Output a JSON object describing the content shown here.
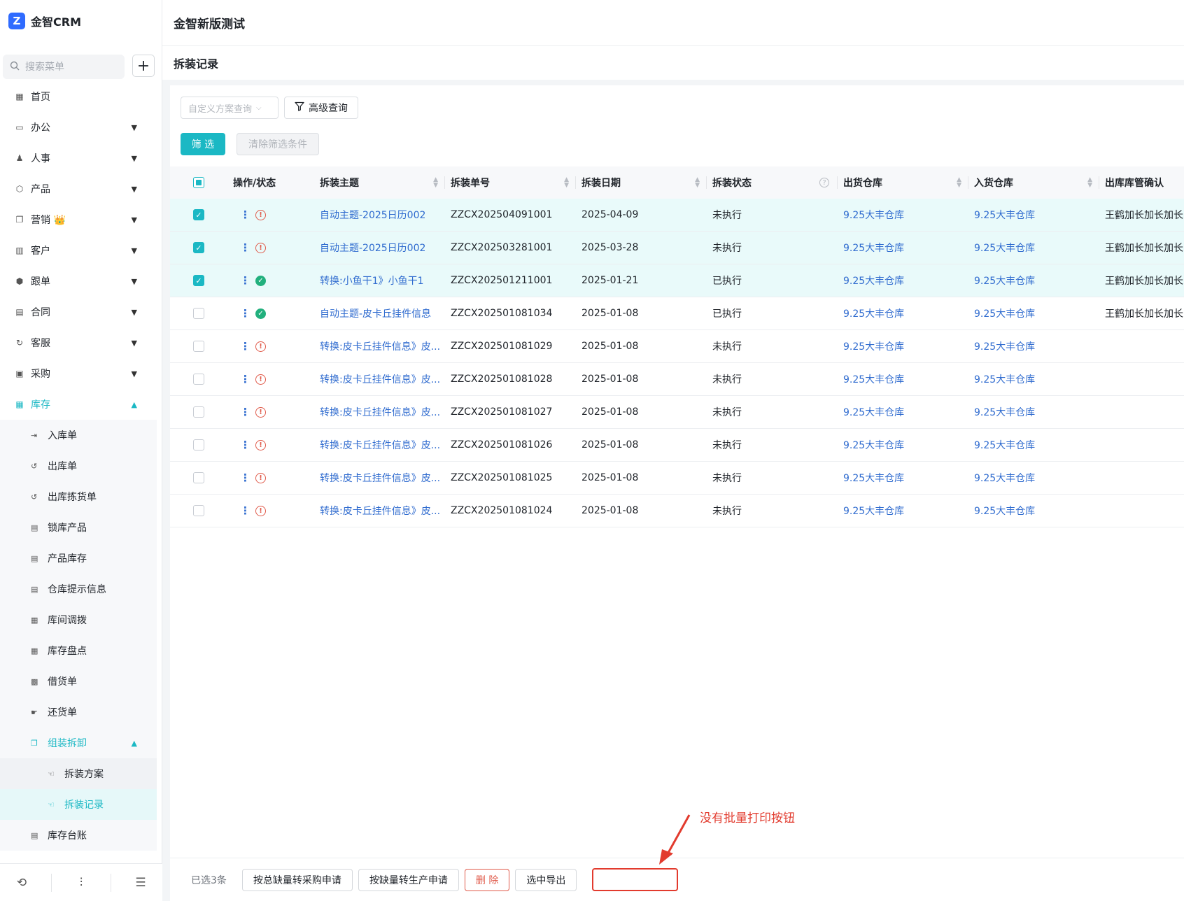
{
  "sidebar": {
    "logo_mark": "Z",
    "logo_text": "金智CRM",
    "search_placeholder": "搜索菜单",
    "add_label": "+",
    "menu": [
      {
        "label": "首页",
        "icon": "home-icon",
        "glyph": "▦",
        "has_children": false
      },
      {
        "label": "办公",
        "icon": "office-icon",
        "glyph": "▭",
        "has_children": true
      },
      {
        "label": "人事",
        "icon": "hr-icon",
        "glyph": "♟",
        "has_children": true
      },
      {
        "label": "产品",
        "icon": "product-icon",
        "glyph": "⬡",
        "has_children": true
      },
      {
        "label": "营销 👑",
        "icon": "marketing-icon",
        "glyph": "❐",
        "has_children": true
      },
      {
        "label": "客户",
        "icon": "customer-icon",
        "glyph": "▥",
        "has_children": true
      },
      {
        "label": "跟单",
        "icon": "follow-icon",
        "glyph": "⬢",
        "has_children": true
      },
      {
        "label": "合同",
        "icon": "contract-icon",
        "glyph": "▤",
        "has_children": true
      },
      {
        "label": "客服",
        "icon": "service-icon",
        "glyph": "↻",
        "has_children": true
      },
      {
        "label": "采购",
        "icon": "purchase-icon",
        "glyph": "▣",
        "has_children": true
      }
    ],
    "active_menu": {
      "label": "库存",
      "icon": "warehouse-icon",
      "glyph": "▦"
    },
    "submenu": [
      {
        "label": "入库单",
        "glyph": "⇥"
      },
      {
        "label": "出库单",
        "glyph": "↺"
      },
      {
        "label": "出库拣货单",
        "glyph": "↺"
      },
      {
        "label": "锁库产品",
        "glyph": "▤"
      },
      {
        "label": "产品库存",
        "glyph": "▤"
      },
      {
        "label": "仓库提示信息",
        "glyph": "▤"
      },
      {
        "label": "库间调拨",
        "glyph": "▦"
      },
      {
        "label": "库存盘点",
        "glyph": "▦"
      },
      {
        "label": "借货单",
        "glyph": "▩"
      },
      {
        "label": "还货单",
        "glyph": "☛"
      }
    ],
    "group": {
      "label": "组装拆卸",
      "glyph": "❐"
    },
    "group_items": [
      {
        "label": "拆装方案",
        "glyph": "☜"
      },
      {
        "label": "拆装记录",
        "glyph": "☜"
      }
    ],
    "after_group": {
      "label": "库存台账",
      "glyph": "▤"
    },
    "footer": [
      {
        "name": "history-icon",
        "glyph": "⟲"
      },
      {
        "name": "settings-sliders-icon",
        "glyph": "⫶"
      },
      {
        "name": "collapse-menu-icon",
        "glyph": "☰"
      }
    ]
  },
  "header": {
    "app_title": "金智新版测试"
  },
  "page": {
    "title": "拆装记录"
  },
  "toolbar": {
    "scheme_placeholder": "自定义方案查询",
    "advanced_query": "高级查询",
    "filter": "筛 选",
    "clear_filter": "清除筛选条件"
  },
  "table": {
    "columns": [
      "操作/状态",
      "拆装主题",
      "拆装单号",
      "拆装日期",
      "拆装状态",
      "出货仓库",
      "入货仓库",
      "出库库管确认"
    ],
    "rows": [
      {
        "checked": true,
        "status": "warn",
        "subject": "自动主题-2025日历002",
        "no": "ZZCX202504091001",
        "date": "2025-04-09",
        "state": "未执行",
        "out_wh": "9.25大丰仓库",
        "in_wh": "9.25大丰仓库",
        "confirm": "王鹤加长加长加长"
      },
      {
        "checked": true,
        "status": "warn",
        "subject": "自动主题-2025日历002",
        "no": "ZZCX202503281001",
        "date": "2025-03-28",
        "state": "未执行",
        "out_wh": "9.25大丰仓库",
        "in_wh": "9.25大丰仓库",
        "confirm": "王鹤加长加长加长"
      },
      {
        "checked": true,
        "status": "ok",
        "subject": "转换:小鱼干1》小鱼干1",
        "no": "ZZCX202501211001",
        "date": "2025-01-21",
        "state": "已执行",
        "out_wh": "9.25大丰仓库",
        "in_wh": "9.25大丰仓库",
        "confirm": "王鹤加长加长加长"
      },
      {
        "checked": false,
        "status": "ok",
        "subject": "自动主题-皮卡丘挂件信息",
        "no": "ZZCX202501081034",
        "date": "2025-01-08",
        "state": "已执行",
        "out_wh": "9.25大丰仓库",
        "in_wh": "9.25大丰仓库",
        "confirm": "王鹤加长加长加长"
      },
      {
        "checked": false,
        "status": "warn",
        "subject": "转换:皮卡丘挂件信息》皮...",
        "no": "ZZCX202501081029",
        "date": "2025-01-08",
        "state": "未执行",
        "out_wh": "9.25大丰仓库",
        "in_wh": "9.25大丰仓库",
        "confirm": ""
      },
      {
        "checked": false,
        "status": "warn",
        "subject": "转换:皮卡丘挂件信息》皮...",
        "no": "ZZCX202501081028",
        "date": "2025-01-08",
        "state": "未执行",
        "out_wh": "9.25大丰仓库",
        "in_wh": "9.25大丰仓库",
        "confirm": ""
      },
      {
        "checked": false,
        "status": "warn",
        "subject": "转换:皮卡丘挂件信息》皮...",
        "no": "ZZCX202501081027",
        "date": "2025-01-08",
        "state": "未执行",
        "out_wh": "9.25大丰仓库",
        "in_wh": "9.25大丰仓库",
        "confirm": ""
      },
      {
        "checked": false,
        "status": "warn",
        "subject": "转换:皮卡丘挂件信息》皮...",
        "no": "ZZCX202501081026",
        "date": "2025-01-08",
        "state": "未执行",
        "out_wh": "9.25大丰仓库",
        "in_wh": "9.25大丰仓库",
        "confirm": ""
      },
      {
        "checked": false,
        "status": "warn",
        "subject": "转换:皮卡丘挂件信息》皮...",
        "no": "ZZCX202501081025",
        "date": "2025-01-08",
        "state": "未执行",
        "out_wh": "9.25大丰仓库",
        "in_wh": "9.25大丰仓库",
        "confirm": ""
      },
      {
        "checked": false,
        "status": "warn",
        "subject": "转换:皮卡丘挂件信息》皮...",
        "no": "ZZCX202501081024",
        "date": "2025-01-08",
        "state": "未执行",
        "out_wh": "9.25大丰仓库",
        "in_wh": "9.25大丰仓库",
        "confirm": ""
      }
    ]
  },
  "actions": {
    "selected_count": "已选3条",
    "buttons": [
      "按总缺量转采购申请",
      "按缺量转生产申请",
      "删 除",
      "选中导出"
    ]
  },
  "annotation": {
    "text": "没有批量打印按钮"
  },
  "colors": {
    "accent": "#1bb8c4",
    "link": "#2f6bcf",
    "danger": "#e05a4a",
    "annotation": "#e23b2e"
  }
}
